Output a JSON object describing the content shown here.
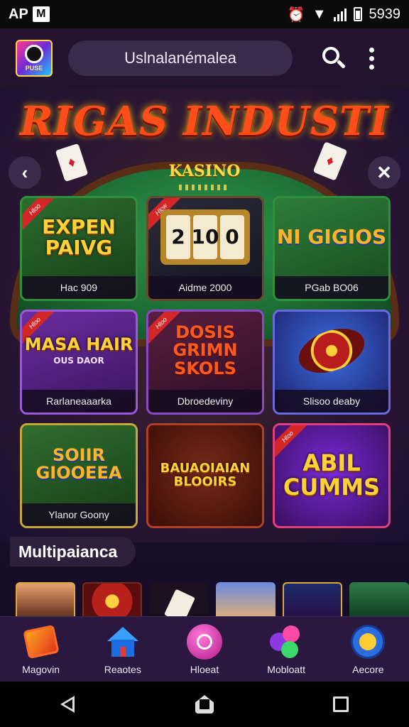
{
  "status_bar": {
    "left_text": "AP",
    "m_icon": "M",
    "time": "5939"
  },
  "app_bar": {
    "logo_text": "PUSE",
    "search_text": "Uslnalanémalea"
  },
  "hero": {
    "title": "RIGAS INDUSTI",
    "table_label": "KASINO"
  },
  "games": [
    {
      "logo": "EXPEN PAIVG",
      "caption": "Hac 909",
      "ribbon": "Hloo"
    },
    {
      "reels": [
        "2",
        "10",
        "0"
      ],
      "caption": "Aidme 2000",
      "ribbon": "Hlcw"
    },
    {
      "logo": "NI GIGIOS",
      "caption": "PGab BO06",
      "ribbon": ""
    },
    {
      "logo": "MASA HAIR",
      "sub": "OUS DAOR",
      "caption": "Rarlaneaaarka",
      "ribbon": "Hloo"
    },
    {
      "logo": "DOSIS GRIMN SKOLS",
      "caption": "Dbroedeviny",
      "ribbon": "Hloo"
    },
    {
      "logo": "",
      "caption": "Slisoo deaby",
      "ribbon": ""
    },
    {
      "logo": "SOIIR GIOOEEA",
      "caption": "Ylanor Goony",
      "ribbon": ""
    },
    {
      "logo": "BAUAOIAIAN BLOOIRS",
      "caption": "",
      "ribbon": ""
    },
    {
      "logo": "ABIL CUMMS",
      "caption": "",
      "ribbon": "Hloo"
    }
  ],
  "section": {
    "title": "Multipaianca"
  },
  "bottom_nav": [
    {
      "label": "Magovin",
      "icon": "gift-icon"
    },
    {
      "label": "Reaotes",
      "icon": "home-icon"
    },
    {
      "label": "Hloeat",
      "icon": "circle-play-icon"
    },
    {
      "label": "Mobloatt",
      "icon": "bubbles-icon"
    },
    {
      "label": "Aecore",
      "icon": "badge-icon"
    }
  ]
}
